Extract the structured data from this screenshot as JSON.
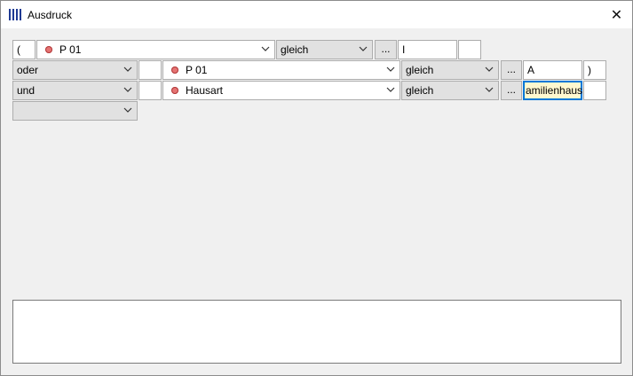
{
  "window": {
    "title": "Ausdruck"
  },
  "rows": [
    {
      "open_paren": "(",
      "field": "P 01",
      "operator": "gleich",
      "browse": "...",
      "value": "I",
      "close_paren": ""
    },
    {
      "connector": "oder",
      "open_paren": "",
      "field": "P 01",
      "operator": "gleich",
      "browse": "...",
      "value": "A",
      "close_paren": ")"
    },
    {
      "connector": "und",
      "open_paren": "",
      "field": "Hausart",
      "operator": "gleich",
      "browse": "...",
      "value": "amilienhaus",
      "close_paren": ""
    },
    {
      "connector": ""
    }
  ],
  "expression_text": "",
  "icons": {
    "app": "columns-icon",
    "close": "close-icon",
    "dropdown": "chevron-down-icon",
    "field": "red-dot-icon"
  }
}
